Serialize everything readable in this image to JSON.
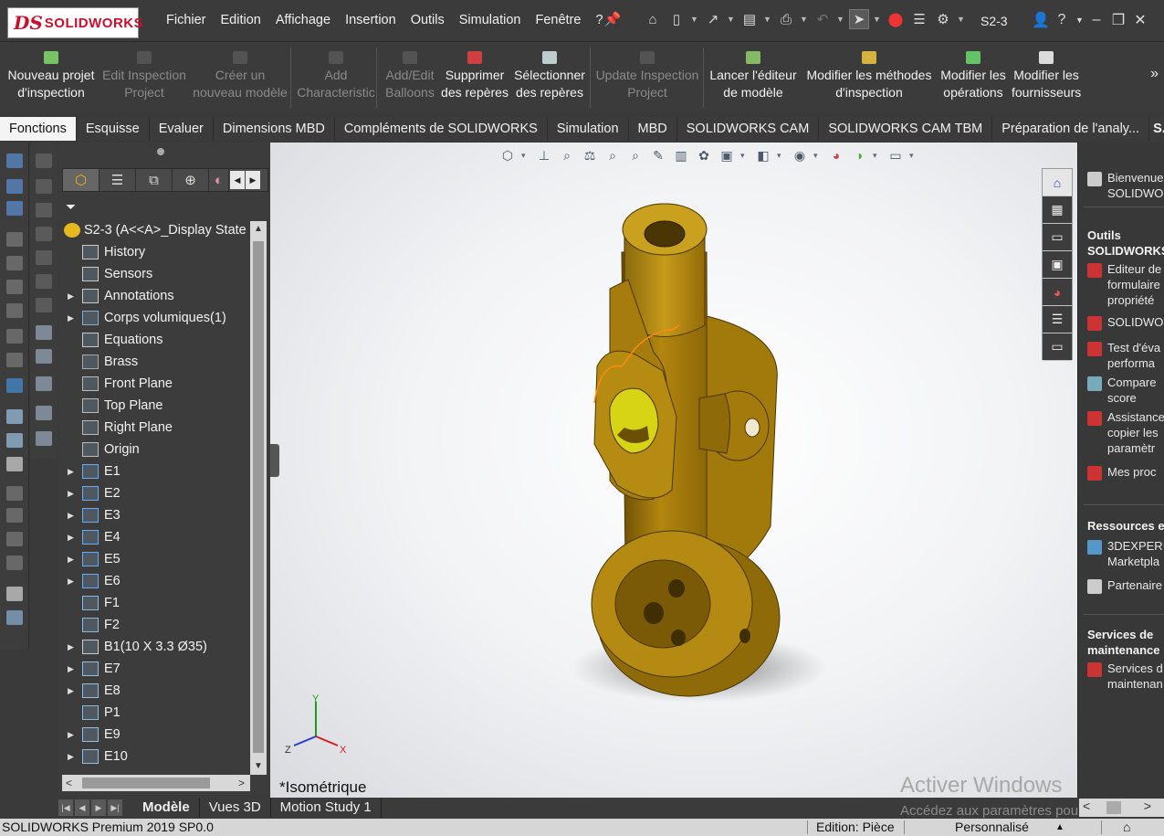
{
  "app": {
    "logo_prefix": "DS",
    "logo_text": "SOLIDWORKS",
    "document": "S2-3"
  },
  "menu": [
    "Fichier",
    "Edition",
    "Affichage",
    "Insertion",
    "Outils",
    "Simulation",
    "Fenêtre",
    "?"
  ],
  "ribbon": [
    {
      "label1": "Nouveau projet",
      "label2": "d'inspection",
      "enabled": true
    },
    {
      "label1": "Edit Inspection",
      "label2": "Project",
      "enabled": false
    },
    {
      "label1": "Créer un",
      "label2": "nouveau modèle",
      "enabled": false
    },
    {
      "label1": "Add",
      "label2": "Characteristic",
      "enabled": false
    },
    {
      "label1": "Add/Edit",
      "label2": "Balloons",
      "enabled": false
    },
    {
      "label1": "Supprimer",
      "label2": "des repères",
      "enabled": true
    },
    {
      "label1": "Sélectionner",
      "label2": "des repères",
      "enabled": true
    },
    {
      "label1": "Update Inspection",
      "label2": "Project",
      "enabled": false
    },
    {
      "label1": "Lancer l'éditeur",
      "label2": "de modèle",
      "enabled": true
    },
    {
      "label1": "Modifier les méthodes",
      "label2": "d'inspection",
      "enabled": true
    },
    {
      "label1": "Modifier les",
      "label2": "opérations",
      "enabled": true
    },
    {
      "label1": "Modifier les",
      "label2": "fournisseurs",
      "enabled": true
    }
  ],
  "ribbon_more": "»",
  "command_tabs": [
    "Fonctions",
    "Esquisse",
    "Evaluer",
    "Dimensions MBD",
    "Compléments de SOLIDWORKS",
    "Simulation",
    "MBD",
    "SOLIDWORKS CAM",
    "SOLIDWORKS CAM TBM",
    "Préparation de l'analy...",
    "S..."
  ],
  "tree": {
    "root": "S2-3  (A<<A>_Display State",
    "nodes": [
      {
        "label": "History",
        "icon": "history-icon",
        "expandable": false
      },
      {
        "label": "Sensors",
        "icon": "sensor-icon",
        "expandable": false
      },
      {
        "label": "Annotations",
        "icon": "annotations-icon",
        "expandable": true
      },
      {
        "label": "Corps volumiques(1)",
        "icon": "solid-bodies-icon",
        "expandable": true
      },
      {
        "label": "Equations",
        "icon": "equations-icon",
        "expandable": false
      },
      {
        "label": "Brass",
        "icon": "material-icon",
        "expandable": false
      },
      {
        "label": "Front Plane",
        "icon": "plane-icon",
        "expandable": false
      },
      {
        "label": "Top Plane",
        "icon": "plane-icon",
        "expandable": false
      },
      {
        "label": "Right Plane",
        "icon": "plane-icon",
        "expandable": false
      },
      {
        "label": "Origin",
        "icon": "origin-icon",
        "expandable": false
      },
      {
        "label": "E1",
        "icon": "extrude-icon",
        "expandable": true
      },
      {
        "label": "E2",
        "icon": "extrude-icon",
        "expandable": true
      },
      {
        "label": "E3",
        "icon": "extrude-icon",
        "expandable": true
      },
      {
        "label": "E4",
        "icon": "extrude-icon",
        "expandable": true
      },
      {
        "label": "E5",
        "icon": "extrude-icon",
        "expandable": true
      },
      {
        "label": "E6",
        "icon": "extrude-icon",
        "expandable": true
      },
      {
        "label": "F1",
        "icon": "fillet-icon",
        "expandable": false
      },
      {
        "label": "F2",
        "icon": "fillet-icon",
        "expandable": false
      },
      {
        "label": "B1(10 X 3.3  Ø35)",
        "icon": "hole-icon",
        "expandable": true
      },
      {
        "label": "E7",
        "icon": "cut-icon",
        "expandable": true
      },
      {
        "label": "E8",
        "icon": "cut-icon",
        "expandable": true
      },
      {
        "label": "P1",
        "icon": "pattern-icon",
        "expandable": false
      },
      {
        "label": "E9",
        "icon": "cut-icon",
        "expandable": true
      },
      {
        "label": "E10",
        "icon": "cut-icon",
        "expandable": true
      }
    ]
  },
  "viewport": {
    "view_name": "*Isométrique",
    "watermark_title": "Activer Windows",
    "watermark_sub": "Accédez aux paramètres pour activer",
    "axis_x": "X",
    "axis_y": "Y",
    "axis_z": "Z"
  },
  "taskpane": {
    "welcome": "Bienvenue\nSOLIDWO",
    "tools_heading": "Outils\nSOLIDWORKS",
    "tools": [
      "Editeur de\nformulaire\npropriété",
      "SOLIDWO",
      "Test d'éva\nperforma",
      "Compare\nscore",
      "Assistance\ncopier les\nparamètr",
      "Mes proc"
    ],
    "resources_heading": "Ressources e",
    "resources": [
      "3DEXPERI\nMarketpla",
      "Partenaire"
    ],
    "services_heading": "Services de\nmaintenance",
    "services": [
      "Services d\nmaintenan"
    ]
  },
  "bottom_tabs": [
    "Modèle",
    "Vues 3D",
    "Motion Study 1"
  ],
  "status": {
    "version": "SOLIDWORKS Premium 2019 SP0.0",
    "mode": "Edition: Pièce",
    "units": "Personnalisé"
  },
  "colors": {
    "brass": "#b88a10",
    "accent": "#c8102e",
    "background": "#3a3a3a"
  }
}
